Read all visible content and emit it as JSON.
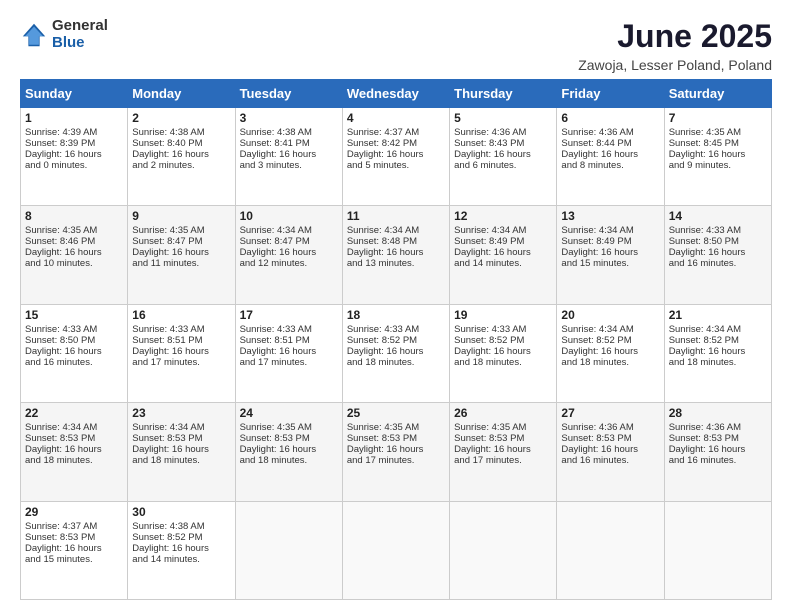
{
  "logo": {
    "general": "General",
    "blue": "Blue"
  },
  "title": "June 2025",
  "subtitle": "Zawoja, Lesser Poland, Poland",
  "days_header": [
    "Sunday",
    "Monday",
    "Tuesday",
    "Wednesday",
    "Thursday",
    "Friday",
    "Saturday"
  ],
  "weeks": [
    [
      {
        "day": 1,
        "lines": [
          "Sunrise: 4:39 AM",
          "Sunset: 8:39 PM",
          "Daylight: 16 hours",
          "and 0 minutes."
        ]
      },
      {
        "day": 2,
        "lines": [
          "Sunrise: 4:38 AM",
          "Sunset: 8:40 PM",
          "Daylight: 16 hours",
          "and 2 minutes."
        ]
      },
      {
        "day": 3,
        "lines": [
          "Sunrise: 4:38 AM",
          "Sunset: 8:41 PM",
          "Daylight: 16 hours",
          "and 3 minutes."
        ]
      },
      {
        "day": 4,
        "lines": [
          "Sunrise: 4:37 AM",
          "Sunset: 8:42 PM",
          "Daylight: 16 hours",
          "and 5 minutes."
        ]
      },
      {
        "day": 5,
        "lines": [
          "Sunrise: 4:36 AM",
          "Sunset: 8:43 PM",
          "Daylight: 16 hours",
          "and 6 minutes."
        ]
      },
      {
        "day": 6,
        "lines": [
          "Sunrise: 4:36 AM",
          "Sunset: 8:44 PM",
          "Daylight: 16 hours",
          "and 8 minutes."
        ]
      },
      {
        "day": 7,
        "lines": [
          "Sunrise: 4:35 AM",
          "Sunset: 8:45 PM",
          "Daylight: 16 hours",
          "and 9 minutes."
        ]
      }
    ],
    [
      {
        "day": 8,
        "lines": [
          "Sunrise: 4:35 AM",
          "Sunset: 8:46 PM",
          "Daylight: 16 hours",
          "and 10 minutes."
        ]
      },
      {
        "day": 9,
        "lines": [
          "Sunrise: 4:35 AM",
          "Sunset: 8:47 PM",
          "Daylight: 16 hours",
          "and 11 minutes."
        ]
      },
      {
        "day": 10,
        "lines": [
          "Sunrise: 4:34 AM",
          "Sunset: 8:47 PM",
          "Daylight: 16 hours",
          "and 12 minutes."
        ]
      },
      {
        "day": 11,
        "lines": [
          "Sunrise: 4:34 AM",
          "Sunset: 8:48 PM",
          "Daylight: 16 hours",
          "and 13 minutes."
        ]
      },
      {
        "day": 12,
        "lines": [
          "Sunrise: 4:34 AM",
          "Sunset: 8:49 PM",
          "Daylight: 16 hours",
          "and 14 minutes."
        ]
      },
      {
        "day": 13,
        "lines": [
          "Sunrise: 4:34 AM",
          "Sunset: 8:49 PM",
          "Daylight: 16 hours",
          "and 15 minutes."
        ]
      },
      {
        "day": 14,
        "lines": [
          "Sunrise: 4:33 AM",
          "Sunset: 8:50 PM",
          "Daylight: 16 hours",
          "and 16 minutes."
        ]
      }
    ],
    [
      {
        "day": 15,
        "lines": [
          "Sunrise: 4:33 AM",
          "Sunset: 8:50 PM",
          "Daylight: 16 hours",
          "and 16 minutes."
        ]
      },
      {
        "day": 16,
        "lines": [
          "Sunrise: 4:33 AM",
          "Sunset: 8:51 PM",
          "Daylight: 16 hours",
          "and 17 minutes."
        ]
      },
      {
        "day": 17,
        "lines": [
          "Sunrise: 4:33 AM",
          "Sunset: 8:51 PM",
          "Daylight: 16 hours",
          "and 17 minutes."
        ]
      },
      {
        "day": 18,
        "lines": [
          "Sunrise: 4:33 AM",
          "Sunset: 8:52 PM",
          "Daylight: 16 hours",
          "and 18 minutes."
        ]
      },
      {
        "day": 19,
        "lines": [
          "Sunrise: 4:33 AM",
          "Sunset: 8:52 PM",
          "Daylight: 16 hours",
          "and 18 minutes."
        ]
      },
      {
        "day": 20,
        "lines": [
          "Sunrise: 4:34 AM",
          "Sunset: 8:52 PM",
          "Daylight: 16 hours",
          "and 18 minutes."
        ]
      },
      {
        "day": 21,
        "lines": [
          "Sunrise: 4:34 AM",
          "Sunset: 8:52 PM",
          "Daylight: 16 hours",
          "and 18 minutes."
        ]
      }
    ],
    [
      {
        "day": 22,
        "lines": [
          "Sunrise: 4:34 AM",
          "Sunset: 8:53 PM",
          "Daylight: 16 hours",
          "and 18 minutes."
        ]
      },
      {
        "day": 23,
        "lines": [
          "Sunrise: 4:34 AM",
          "Sunset: 8:53 PM",
          "Daylight: 16 hours",
          "and 18 minutes."
        ]
      },
      {
        "day": 24,
        "lines": [
          "Sunrise: 4:35 AM",
          "Sunset: 8:53 PM",
          "Daylight: 16 hours",
          "and 18 minutes."
        ]
      },
      {
        "day": 25,
        "lines": [
          "Sunrise: 4:35 AM",
          "Sunset: 8:53 PM",
          "Daylight: 16 hours",
          "and 17 minutes."
        ]
      },
      {
        "day": 26,
        "lines": [
          "Sunrise: 4:35 AM",
          "Sunset: 8:53 PM",
          "Daylight: 16 hours",
          "and 17 minutes."
        ]
      },
      {
        "day": 27,
        "lines": [
          "Sunrise: 4:36 AM",
          "Sunset: 8:53 PM",
          "Daylight: 16 hours",
          "and 16 minutes."
        ]
      },
      {
        "day": 28,
        "lines": [
          "Sunrise: 4:36 AM",
          "Sunset: 8:53 PM",
          "Daylight: 16 hours",
          "and 16 minutes."
        ]
      }
    ],
    [
      {
        "day": 29,
        "lines": [
          "Sunrise: 4:37 AM",
          "Sunset: 8:53 PM",
          "Daylight: 16 hours",
          "and 15 minutes."
        ]
      },
      {
        "day": 30,
        "lines": [
          "Sunrise: 4:38 AM",
          "Sunset: 8:52 PM",
          "Daylight: 16 hours",
          "and 14 minutes."
        ]
      },
      null,
      null,
      null,
      null,
      null
    ]
  ]
}
